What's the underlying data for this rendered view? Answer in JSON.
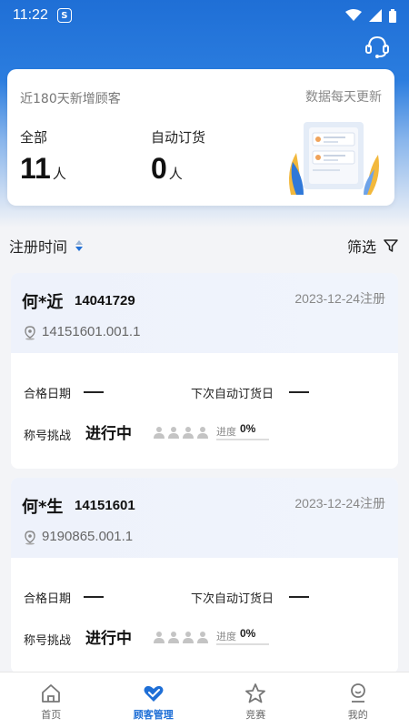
{
  "status_bar": {
    "time": "11:22",
    "app_badge": "S"
  },
  "summary": {
    "subtitle": "近180天新增顾客",
    "update_note": "数据每天更新",
    "all_label": "全部",
    "all_count": "11",
    "all_unit": "人",
    "auto_label": "自动订货",
    "auto_count": "0",
    "auto_unit": "人"
  },
  "sort": {
    "label": "注册时间",
    "filter_label": "筛选"
  },
  "customers": [
    {
      "name": "何*近",
      "id": "14041729",
      "registered": "2023-12-24注册",
      "code": "14151601.001.1",
      "qualify_label": "合格日期",
      "next_order_label": "下次自动订货日",
      "title_label": "称号挑战",
      "title_state": "进行中",
      "progress_label": "进度",
      "progress_value": "0%",
      "progress_fraction": 0
    },
    {
      "name": "何*生",
      "id": "14151601",
      "registered": "2023-12-24注册",
      "code": "9190865.001.1",
      "qualify_label": "合格日期",
      "next_order_label": "下次自动订货日",
      "title_label": "称号挑战",
      "title_state": "进行中",
      "progress_label": "进度",
      "progress_value": "0%",
      "progress_fraction": 0
    }
  ],
  "nav": [
    {
      "label": "首页",
      "icon": "home-icon"
    },
    {
      "label": "顾客管理",
      "icon": "heart-hands-icon",
      "active": true
    },
    {
      "label": "竞赛",
      "icon": "star-icon"
    },
    {
      "label": "我的",
      "icon": "profile-icon"
    }
  ],
  "colors": {
    "primary": "#1f6fd6",
    "background": "#f3f4f7"
  }
}
